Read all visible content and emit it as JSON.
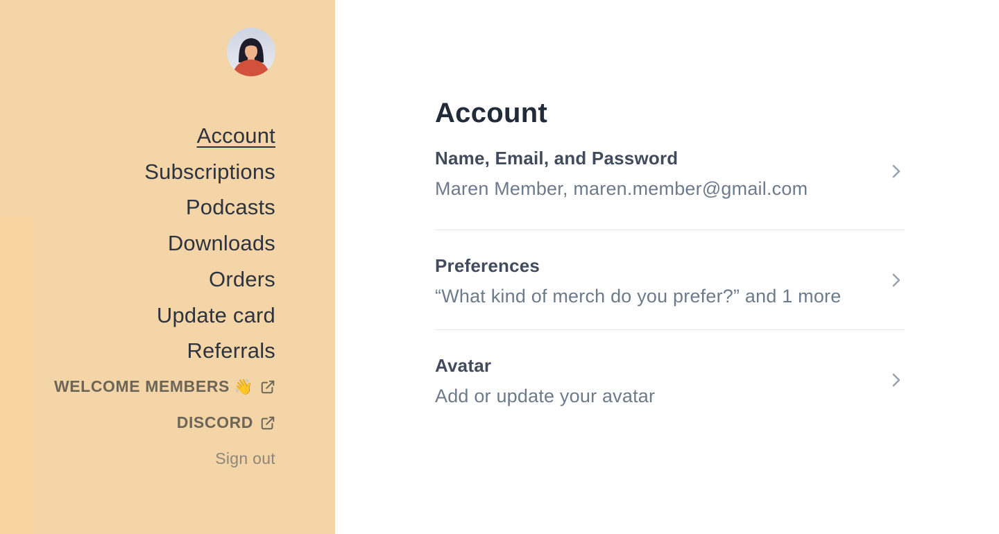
{
  "sidebar": {
    "avatar": {
      "label": "user-avatar"
    },
    "nav": [
      {
        "label": "Account",
        "active": true
      },
      {
        "label": "Subscriptions"
      },
      {
        "label": "Podcasts"
      },
      {
        "label": "Downloads"
      },
      {
        "label": "Orders"
      },
      {
        "label": "Update card"
      },
      {
        "label": "Referrals"
      }
    ],
    "external_links": [
      {
        "label": "WELCOME MEMBERS",
        "emoji": "👋",
        "icon": "external-link-icon"
      },
      {
        "label": "DISCORD",
        "icon": "external-link-icon"
      }
    ],
    "sign_out": "Sign out"
  },
  "main": {
    "title": "Account",
    "rows": [
      {
        "title": "Name, Email, and Password",
        "subtitle": "Maren Member, maren.member@gmail.com",
        "icon": "chevron-right-icon"
      },
      {
        "title": "Preferences",
        "subtitle": "“What kind of merch do you prefer?” and 1 more",
        "icon": "chevron-right-icon"
      },
      {
        "title": "Avatar",
        "subtitle": "Add or update your avatar",
        "icon": "chevron-right-icon"
      }
    ]
  },
  "colors": {
    "sidebar_bg": "#f3d5a7",
    "text_dark": "#2e3340",
    "text_muted": "#6d7a8c",
    "divider": "#e6e7ea"
  }
}
